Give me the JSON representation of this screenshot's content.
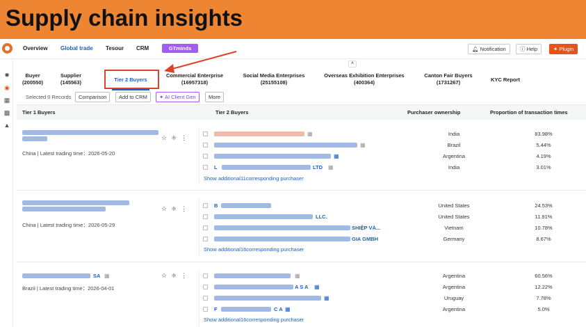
{
  "banner": {
    "title": "Supply chain insights"
  },
  "topnav": {
    "items": [
      "Overview",
      "Global trade",
      "Tesour",
      "CRM"
    ],
    "gtminds": "GTminds",
    "notification": "Notification",
    "help": "Help",
    "plugin": "Plugin"
  },
  "tabs": [
    {
      "label": "Buyer",
      "count": "(200550)"
    },
    {
      "label": "Supplier",
      "count": "(145563)"
    },
    {
      "label": "Tier 2 Buyers",
      "count": ""
    },
    {
      "label": "Commercial Enterprise",
      "count": "(16957318)"
    },
    {
      "label": "Social Media Enterprises",
      "count": "(25155108)"
    },
    {
      "label": "Overseas Exhibition Enterprises",
      "count": "(400364)"
    },
    {
      "label": "Canton Fair Buyers",
      "count": "(1731267)"
    },
    {
      "label": "KYC Report",
      "count": ""
    }
  ],
  "actions": {
    "selected": "Selected 0 Records",
    "comparison": "Comparison",
    "add_crm": "Add to CRM",
    "ai_client": "AI Client Gen",
    "more": "More"
  },
  "columns": {
    "tier1": "Tier 1 Buyers",
    "tier2": "Tier 2 Buyers",
    "ownership": "Purchaser ownership",
    "proportion": "Proportion of transaction times"
  },
  "groups": [
    {
      "meta": "China | Latest trading time：2026-05-20",
      "name_suffix": "",
      "buyers": [
        {
          "name_visible": "",
          "country": "India",
          "pct": "83.98%"
        },
        {
          "name_visible": "",
          "country": "Brazil",
          "pct": "5.44%"
        },
        {
          "name_visible": "",
          "country": "Argentina",
          "pct": "4.19%"
        },
        {
          "name_visible": "LTD",
          "prefix": "L",
          "country": "India",
          "pct": "3.01%"
        }
      ],
      "more": "Show additional11corresponding purchaser"
    },
    {
      "meta": "China | Latest trading time：2026-05-29",
      "name_suffix": "",
      "buyers": [
        {
          "name_visible": "",
          "prefix": "B",
          "country": "United States",
          "pct": "24.53%"
        },
        {
          "name_visible": "LLC.",
          "country": "United States",
          "pct": "11.91%"
        },
        {
          "name_visible": "SHIỆP VÀ...",
          "country": "Vietnam",
          "pct": "10.78%"
        },
        {
          "name_visible": "GIA GMBH",
          "country": "Germany",
          "pct": "8.67%"
        }
      ],
      "more": "Show additional16corresponding purchaser"
    },
    {
      "meta": "Brazil | Latest trading time：2026-04-01",
      "name_suffix": "SA",
      "buyers": [
        {
          "name_visible": "",
          "country": "Argentina",
          "pct": "60.56%"
        },
        {
          "name_visible": "A S A",
          "country": "Argentina",
          "pct": "12.22%"
        },
        {
          "name_visible": "",
          "country": "Uruguay",
          "pct": "7.78%"
        },
        {
          "name_visible": "C A",
          "prefix": "F",
          "country": "Argentina",
          "pct": "5.0%"
        }
      ],
      "more": "Show additional16corresponding purchaser"
    }
  ]
}
